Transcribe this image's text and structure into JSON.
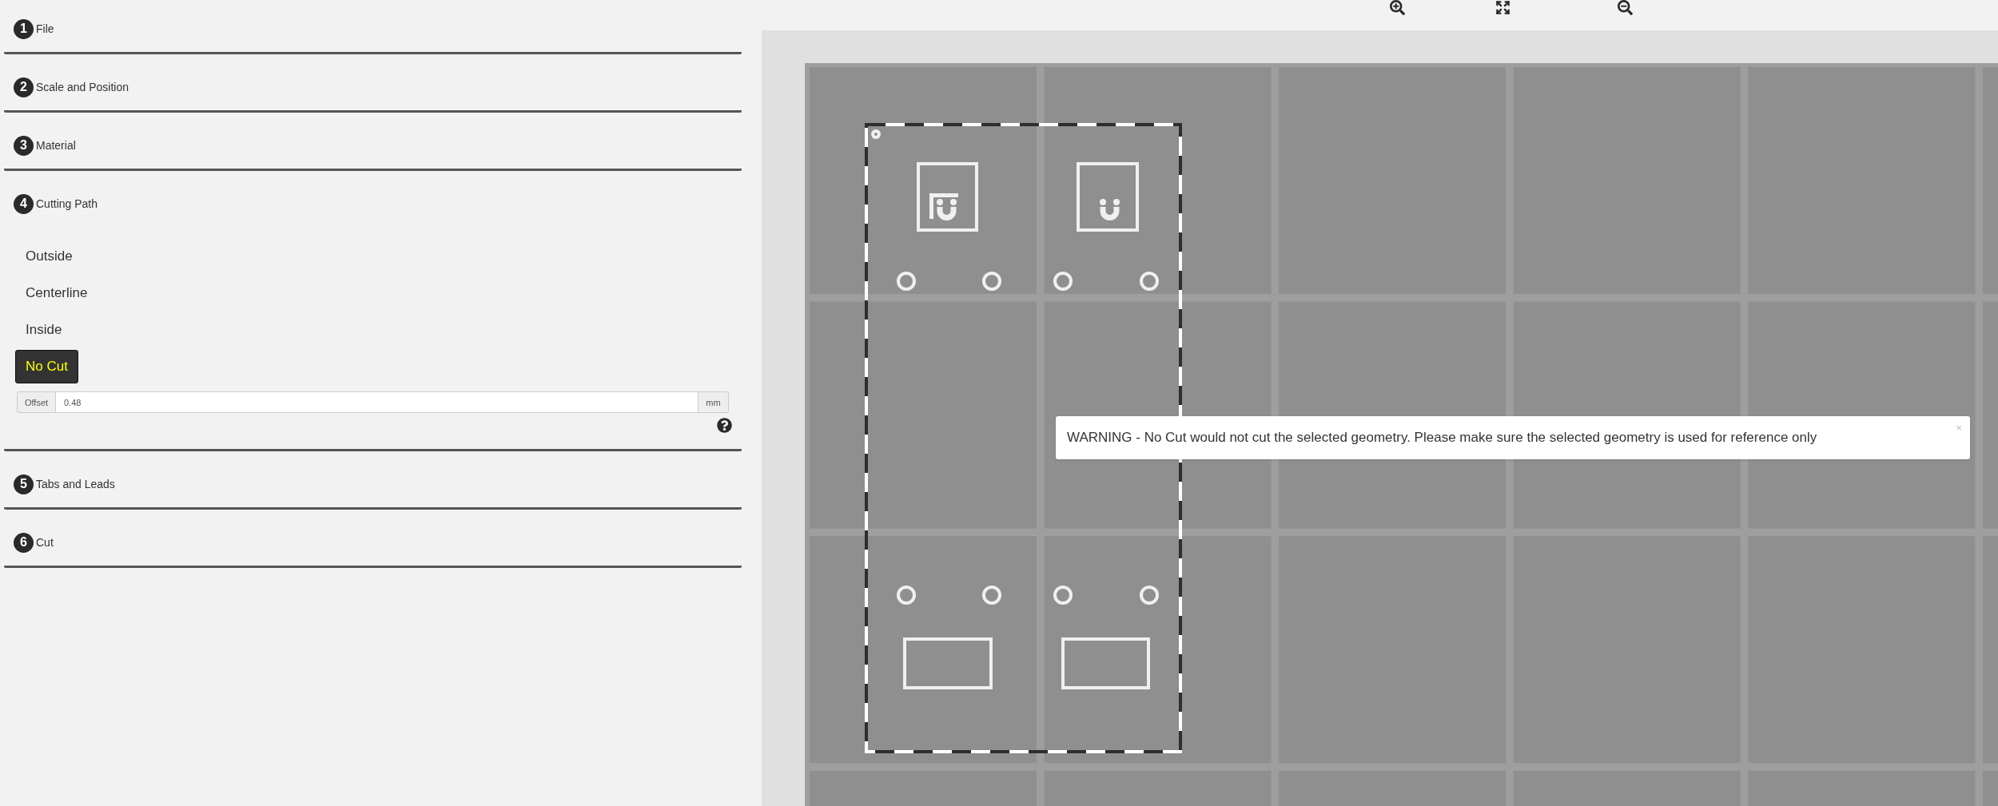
{
  "sidebar": {
    "sections": [
      {
        "number": "1",
        "title": "File"
      },
      {
        "number": "2",
        "title": "Scale and Position"
      },
      {
        "number": "3",
        "title": "Material"
      },
      {
        "number": "4",
        "title": "Cutting Path",
        "options": [
          {
            "label": "Outside",
            "selected": false
          },
          {
            "label": "Centerline",
            "selected": false
          },
          {
            "label": "Inside",
            "selected": false
          },
          {
            "label": "No Cut",
            "selected": true
          }
        ],
        "offset": {
          "label": "Offset",
          "value": "0.48",
          "unit": "mm"
        }
      },
      {
        "number": "5",
        "title": "Tabs and Leads"
      },
      {
        "number": "6",
        "title": "Cut"
      }
    ]
  },
  "warning": {
    "message": "WARNING - No Cut would not cut the selected geometry. Please make sure the selected geometry is used for reference only",
    "close": "×"
  }
}
